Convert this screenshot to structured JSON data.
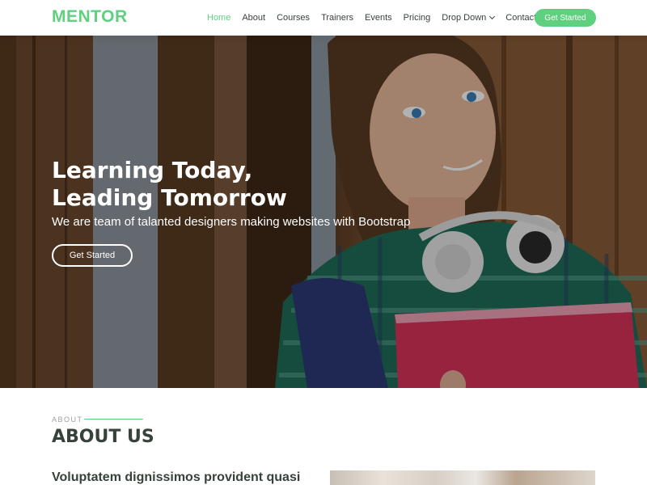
{
  "brand": {
    "logo": "MENTOR",
    "accent": "#5fcf80"
  },
  "nav": {
    "items": [
      {
        "label": "Home",
        "active": true
      },
      {
        "label": "About"
      },
      {
        "label": "Courses"
      },
      {
        "label": "Trainers"
      },
      {
        "label": "Events"
      },
      {
        "label": "Pricing"
      },
      {
        "label": "Drop Down",
        "icon": "chevron-down-icon"
      },
      {
        "label": "Contact"
      }
    ],
    "cta": "Get Started"
  },
  "hero": {
    "title_line1": "Learning Today,",
    "title_line2": "Leading Tomorrow",
    "subtitle": "We are team of talanted designers making websites with Bootstrap",
    "button": "Get Started"
  },
  "about": {
    "kicker": "ABOUT",
    "title": "ABOUT US",
    "lead": "Voluptatem dignissimos provident quasi"
  }
}
